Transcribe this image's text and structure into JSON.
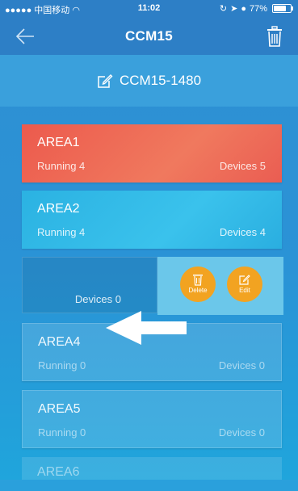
{
  "status_bar": {
    "carrier": "●●●●● 中国移动",
    "time": "11:02",
    "battery_text": "77%",
    "battery_level": 0.77
  },
  "nav": {
    "title": "CCM15",
    "back_icon": "back-arrow-icon",
    "delete_icon": "trash-icon"
  },
  "controller": {
    "name": "CCM15-1480",
    "icon": "edit-icon"
  },
  "areas": [
    {
      "name": "AREA1",
      "running": "Running 4",
      "devices": "Devices 5"
    },
    {
      "name": "AREA2",
      "running": "Running 4",
      "devices": "Devices 4"
    },
    {
      "name": "",
      "running": "",
      "devices": "Devices 0"
    },
    {
      "name": "AREA4",
      "running": "Running 0",
      "devices": "Devices 0"
    },
    {
      "name": "AREA5",
      "running": "Running 0",
      "devices": "Devices 0"
    },
    {
      "name": "AREA6",
      "running": "",
      "devices": ""
    }
  ],
  "swipe_actions": {
    "delete_label": "Delete",
    "edit_label": "Edit"
  },
  "colors": {
    "active_card": "#ec5a4d",
    "normal_card": "#2bb2e2",
    "action_button": "#f2a321",
    "header": "#2d7fc6"
  }
}
